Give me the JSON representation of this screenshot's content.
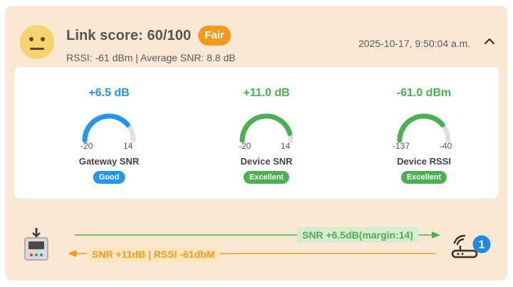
{
  "header": {
    "title": "Link score: 60/100",
    "badge": "Fair",
    "subtitle": "RSSI: -61 dBm | Average SNR: 8.8 dB",
    "timestamp": "2025-10-17, 9:50:04 a.m.",
    "mood_icon": "neutral-face-icon",
    "collapse_icon": "chevron-up-icon"
  },
  "gauges": [
    {
      "value": "+6.5 dB",
      "min": "-20",
      "max": "14",
      "level": 0.78,
      "label": "Gateway SNR",
      "badge": "Good",
      "color": "#2196f3"
    },
    {
      "value": "+11.0 dB",
      "min": "-20",
      "max": "14",
      "level": 0.91,
      "label": "Device SNR",
      "badge": "Excellent",
      "color": "#4caf50"
    },
    {
      "value": "-61.0 dBm",
      "min": "-137",
      "max": "-40",
      "level": 0.78,
      "label": "Device RSSI",
      "badge": "Excellent",
      "color": "#4caf50"
    }
  ],
  "link": {
    "uplink_label": "SNR +6.5dB(margin:14)",
    "downlink_label": "SNR +11dB | RSSI -61dbM",
    "uplink_color": "#4caf50",
    "downlink_color": "#f39a1b",
    "gateway_count": "1",
    "device_icon": "end-device-icon",
    "gateway_icon": "gateway-router-icon"
  },
  "colors": {
    "card_bg": "#fbe8d3",
    "accent_orange": "#f39a1b",
    "gauge_track": "#e0e0e0"
  }
}
